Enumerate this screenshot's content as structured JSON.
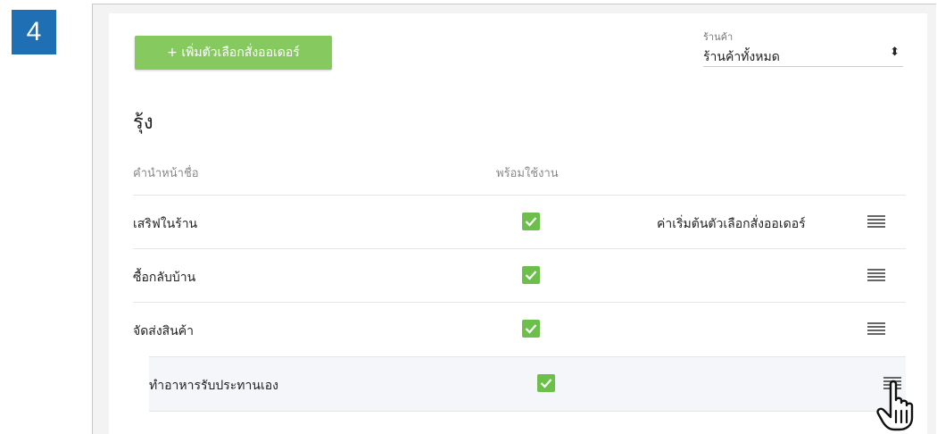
{
  "step": "4",
  "toolbar": {
    "add_label": "+ เพิ่มตัวเลือกสั่งออเดอร์"
  },
  "store_filter": {
    "label": "ร้านค้า",
    "value": "ร้านค้าทั้งหมด",
    "arrow_icon": "sort-icon"
  },
  "section": {
    "title": "รุ้ง"
  },
  "columns": {
    "name": "คำนำหน้าชื่อ",
    "enabled": "พร้อมใช้งาน"
  },
  "rows": [
    {
      "name": "เสริฟในร้าน",
      "enabled": true,
      "default_label": "ค่าเริ่มต้นตัวเลือกสั่งออเดอร์"
    },
    {
      "name": "ซื้อกลับบ้าน",
      "enabled": true,
      "default_label": ""
    },
    {
      "name": "จัดส่งสินค้า",
      "enabled": true,
      "default_label": ""
    },
    {
      "name": "ทำอาหารรับประทานเอง",
      "enabled": true,
      "default_label": ""
    }
  ],
  "colors": {
    "accent_green": "#86c95f",
    "checkbox_green": "#6dbf4b",
    "badge_blue": "#1f6fb5"
  }
}
